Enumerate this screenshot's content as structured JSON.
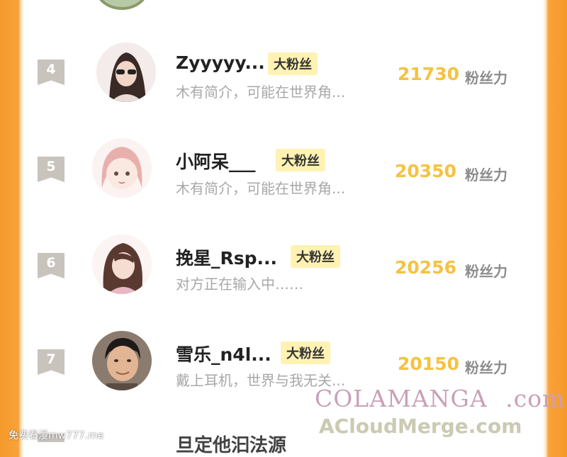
{
  "unit_label": "粉丝力",
  "badge_label": "大粉丝",
  "rows": [
    {
      "rank": "4",
      "name": "Zyyyyy...",
      "bio": "木有简介，可能在世界角...",
      "score": "21730"
    },
    {
      "rank": "5",
      "name": "小阿呆___",
      "bio": "木有简介，可能在世界角...",
      "score": "20350"
    },
    {
      "rank": "6",
      "name": "挽星_Rsp...",
      "bio": "对方正在输入中……",
      "score": "20256"
    },
    {
      "rank": "7",
      "name": "雪乐_n4l...",
      "bio": "戴上耳机，世界与我无关...",
      "score": "20150"
    }
  ],
  "next_row_partial_name": "旦定他汩法源",
  "watermark": {
    "line1_a": "COLA",
    "line1_b": "MANGA",
    "line1_c": ".com",
    "line2": "ACloudMerge.com",
    "corner": "免费看漫mw777.me"
  },
  "colors": {
    "score": "#f5c242",
    "badge_bg": "#fff2b3",
    "frame_orange": "#f59a2a",
    "rank_tag": "#c9c3be"
  }
}
